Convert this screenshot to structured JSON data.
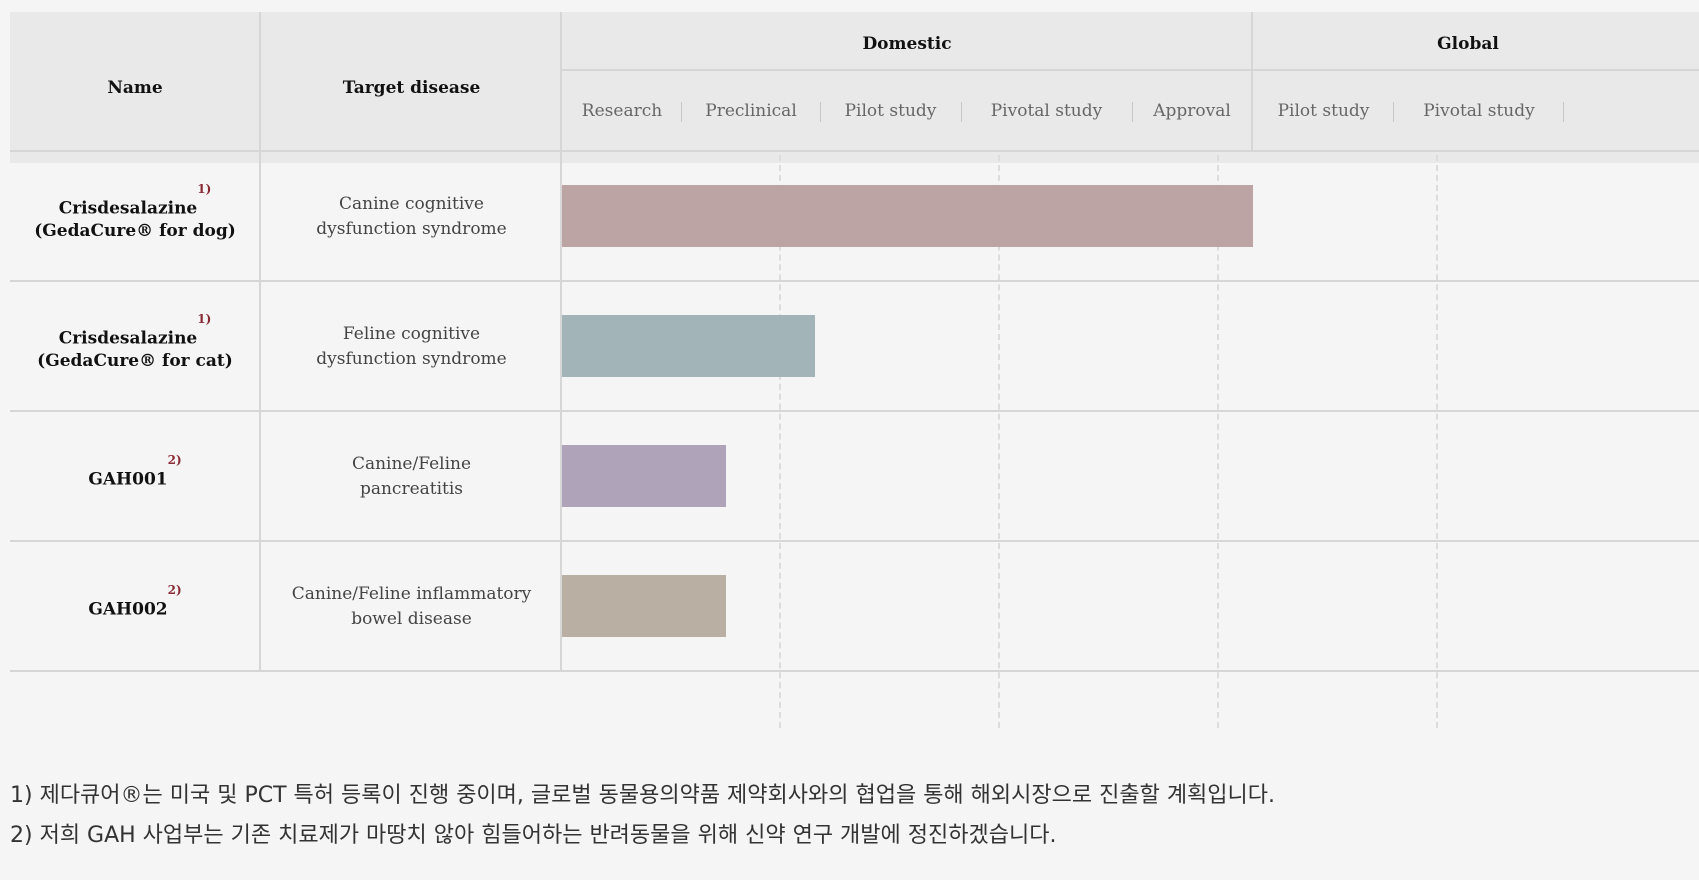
{
  "table": {
    "headers": {
      "name": "Name",
      "target": "Target disease",
      "domestic": "Domestic",
      "global": "Global"
    },
    "phases_domestic": [
      "Research",
      "Preclinical",
      "Pilot study",
      "Pivotal study",
      "Approval"
    ],
    "phases_global": [
      "Pilot study",
      "Pivotal study"
    ],
    "rows": [
      {
        "name": "Crisdesalazine",
        "name_sub": "(GedaCure® for dog)",
        "footnote": "1)",
        "disease_line1": "Canine cognitive",
        "disease_line2": "dysfunction syndrome"
      },
      {
        "name": "Crisdesalazine",
        "name_sub": "(GedaCure® for cat)",
        "footnote": "1)",
        "disease_line1": "Feline cognitive",
        "disease_line2": "dysfunction syndrome"
      },
      {
        "name": "GAH001",
        "name_sub": "",
        "footnote": "2)",
        "disease_line1": "Canine/Feline",
        "disease_line2": "pancreatitis"
      },
      {
        "name": "GAH002",
        "name_sub": "",
        "footnote": "2)",
        "disease_line1": "Canine/Feline inflammatory",
        "disease_line2": "bowel disease"
      }
    ]
  },
  "chart_data": {
    "type": "bar",
    "orientation": "horizontal",
    "categories": [
      "Crisdesalazine (GedaCure® for dog)",
      "Crisdesalazine (GedaCure® for cat)",
      "GAH001",
      "GAH002"
    ],
    "stages": [
      "Research",
      "Preclinical",
      "Pilot study",
      "Pivotal study",
      "Approval",
      "Global Pilot study",
      "Global Pivotal study"
    ],
    "values": [
      5.0,
      1.83,
      1.19,
      1.19
    ],
    "colors": [
      "#bba4a3",
      "#a2b4b8",
      "#afa3b9",
      "#b9afa3"
    ],
    "grid": "dashed vertical"
  },
  "notes": [
    "1) 제다큐어®는 미국 및 PCT 특허 등록이 진행 중이며, 글로벌 동물용의약품 제약회사와의 협업을 통해 해외시장으로 진출할 계획입니다.",
    "2) 저희 GAH 사업부는 기존 치료제가 마땅치 않아 힘들어하는 반려동물을 위해 신약 연구 개발에 정진하겠습니다."
  ]
}
